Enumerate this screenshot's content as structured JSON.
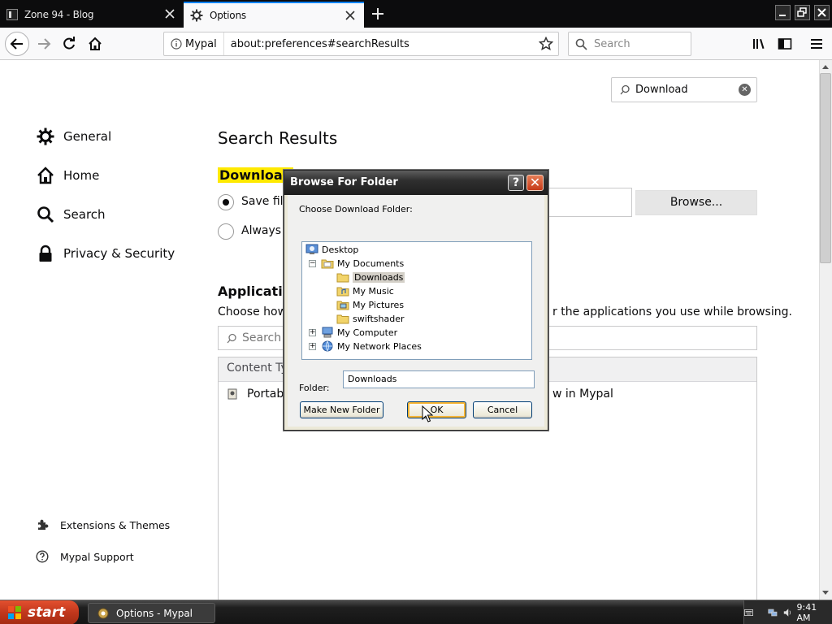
{
  "browser": {
    "tabs": [
      {
        "title": "Zone 94 - Blog"
      },
      {
        "title": "Options"
      }
    ],
    "identity_label": "Mypal",
    "url": "about:preferences#searchResults",
    "search_placeholder": "Search"
  },
  "prefs": {
    "find_value": "Download",
    "categories": [
      "General",
      "Home",
      "Search",
      "Privacy & Security"
    ],
    "footer_links": [
      "Extensions & Themes",
      "Mypal Support"
    ],
    "results_title": "Search Results",
    "downloads_heading": "Download",
    "save_files_label": "Save files",
    "always_ask_label": "Always a",
    "browse_button": "Browse...",
    "apps_heading": "Application",
    "apps_desc_left": "Choose how",
    "apps_desc_right": "r the applications you use while browsing.",
    "apps_search_placeholder": "Search fil",
    "table_header": "Content Ty",
    "row_type": "Portabl",
    "row_action": "w in Mypal"
  },
  "dialog": {
    "title": "Browse For Folder",
    "instruction": "Choose Download Folder:",
    "tree": [
      {
        "label": "Desktop",
        "icon": "desktop-icon"
      },
      {
        "label": "My Documents",
        "icon": "folder-icon"
      },
      {
        "label": "Downloads",
        "icon": "folder-icon",
        "selected": true
      },
      {
        "label": "My Music",
        "icon": "music-folder-icon"
      },
      {
        "label": "My Pictures",
        "icon": "pictures-folder-icon"
      },
      {
        "label": "swiftshader",
        "icon": "folder-icon"
      },
      {
        "label": "My Computer",
        "icon": "computer-icon"
      },
      {
        "label": "My Network Places",
        "icon": "network-icon"
      }
    ],
    "folder_label": "Folder:",
    "folder_value": "Downloads",
    "make_new_folder": "Make New Folder",
    "ok": "OK",
    "cancel": "Cancel"
  },
  "taskbar": {
    "start": "start",
    "task": "Options - Mypal",
    "clock": "9:41 AM"
  },
  "colors": {
    "highlight": "#ffe900",
    "tab_accent": "#0a84ff",
    "start_button": "#c1371c"
  }
}
